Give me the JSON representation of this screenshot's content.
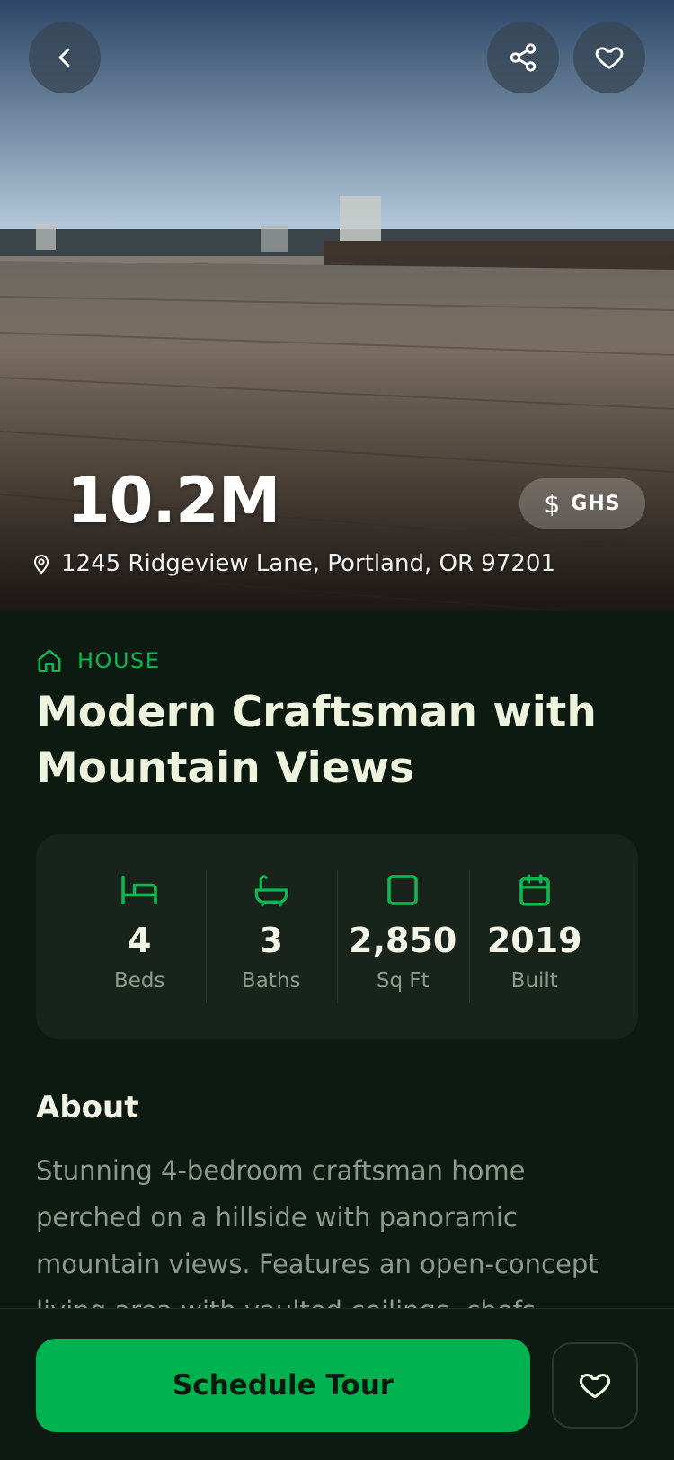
{
  "hero": {
    "price": "10.2M",
    "currency_symbol": "$",
    "currency_code": "GHS",
    "address": "1245 Ridgeview Lane, Portland, OR 97201"
  },
  "listing": {
    "type": "HOUSE",
    "title": "Modern Craftsman with Mountain Views"
  },
  "stats": [
    {
      "icon": "bed-icon",
      "value": "4",
      "label": "Beds"
    },
    {
      "icon": "bath-icon",
      "value": "3",
      "label": "Baths"
    },
    {
      "icon": "square-icon",
      "value": "2,850",
      "label": "Sq Ft"
    },
    {
      "icon": "calendar-icon",
      "value": "2019",
      "label": "Built"
    }
  ],
  "about": {
    "heading": "About",
    "text": "Stunning 4-bedroom craftsman home perched on a hillside with panoramic mountain views. Features an open-concept living area with vaulted ceilings, chefs"
  },
  "actions": {
    "schedule_label": "Schedule Tour"
  },
  "colors": {
    "accent": "#00b350",
    "background": "#0d1a12",
    "card": "#17231b"
  }
}
